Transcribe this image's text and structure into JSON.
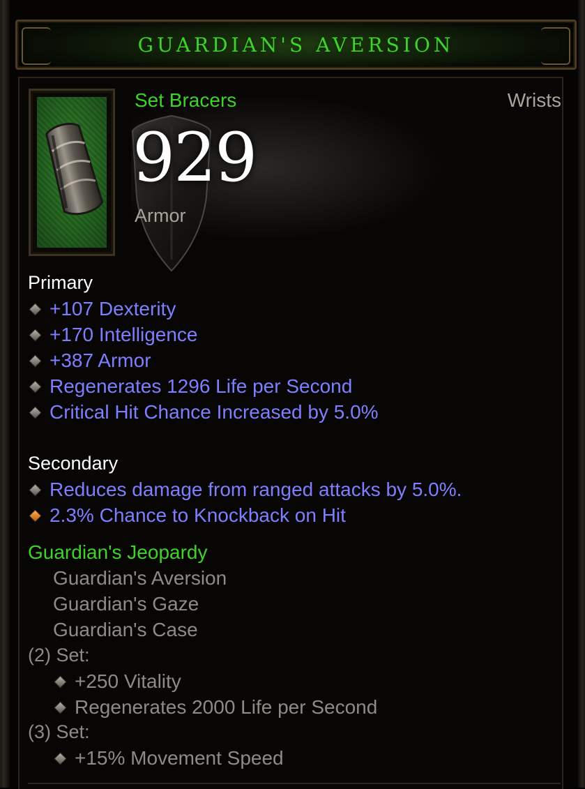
{
  "banner": {
    "title": "GUARDIAN'S AVERSION"
  },
  "item": {
    "type": "Set Bracers",
    "slot": "Wrists",
    "armor_value": "929",
    "armor_label": "Armor"
  },
  "primary": {
    "heading": "Primary",
    "stats": [
      "+107 Dexterity",
      "+170 Intelligence",
      "+387 Armor",
      "Regenerates 1296 Life per Second",
      "Critical Hit Chance Increased by 5.0%"
    ]
  },
  "secondary": {
    "heading": "Secondary",
    "stats": [
      "Reduces damage from ranged attacks by 5.0%.",
      "2.3% Chance to Knockback on Hit"
    ]
  },
  "set": {
    "name": "Guardian's Jeopardy",
    "pieces": [
      "Guardian's Aversion",
      "Guardian's Gaze",
      "Guardian's Case"
    ],
    "bonus2_label": "(2) Set:",
    "bonus2": [
      "+250 Vitality",
      "Regenerates 2000 Life per Second"
    ],
    "bonus3_label": "(3) Set:",
    "bonus3": [
      "+15% Movement Speed"
    ]
  },
  "colors": {
    "set_green": "#3fd22a",
    "magic_blue": "#7e7fff",
    "gray_text": "#8f8a83",
    "white": "#ffffff"
  },
  "icons": {
    "item_icon": "bracers-icon",
    "armor_background": "shield-icon",
    "bullet": "diamond-bullet-icon",
    "secondary_bullet": "orange-diamond-bullet-icon"
  }
}
